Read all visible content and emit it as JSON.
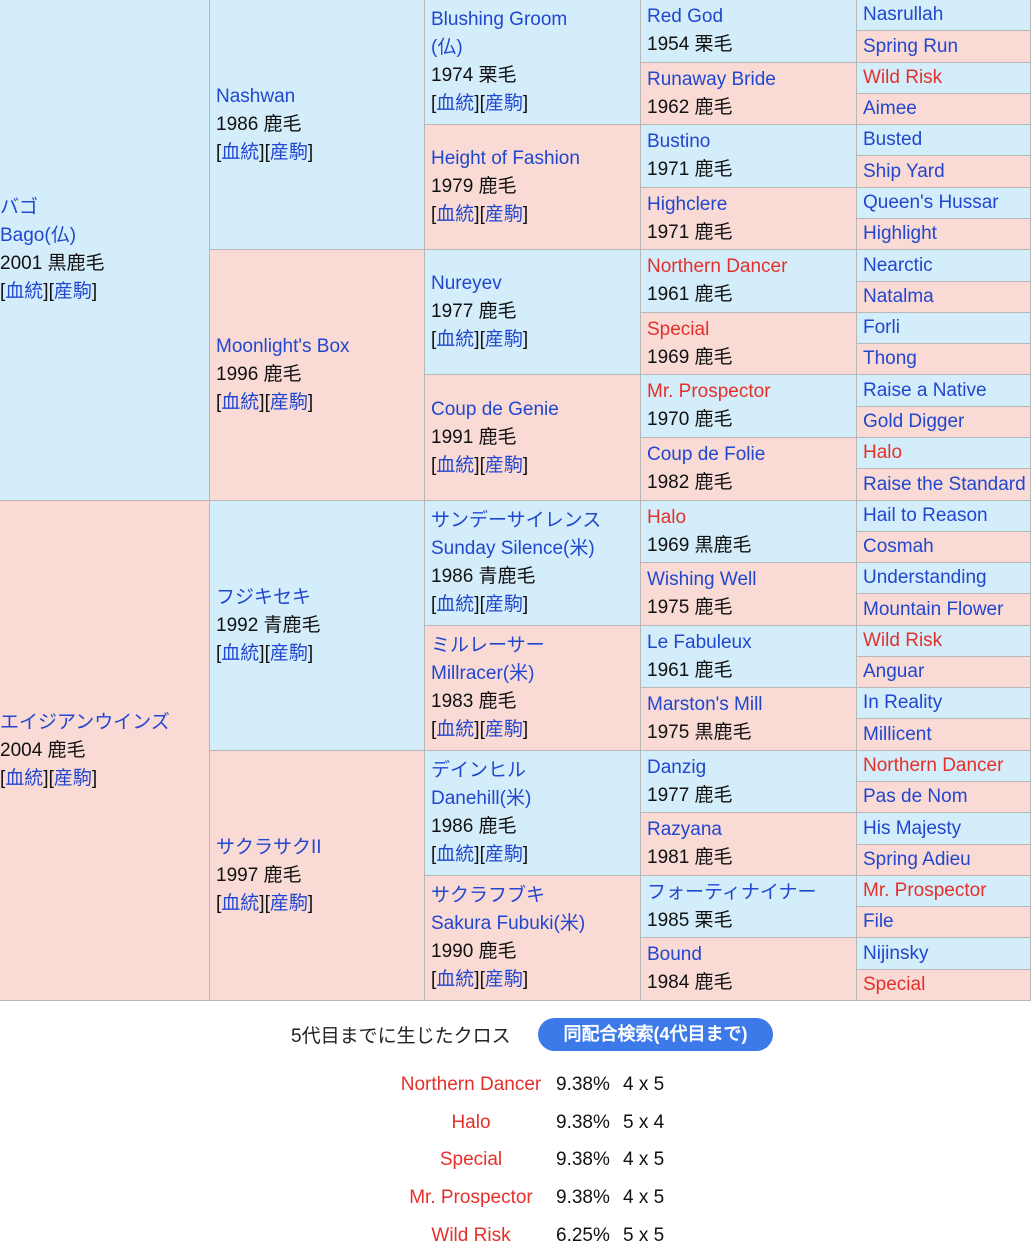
{
  "links": {
    "blood": "血統",
    "foals": "産駒"
  },
  "gen1": [
    {
      "names": [
        "バゴ",
        "Bago(仏)"
      ],
      "info": "2001 黒鹿毛"
    },
    {
      "names": [
        "エイジアンウインズ"
      ],
      "info": "2004 鹿毛"
    }
  ],
  "gen2": [
    {
      "names": [
        "Nashwan"
      ],
      "info": "1986 鹿毛"
    },
    {
      "names": [
        "Moonlight's Box"
      ],
      "info": "1996 鹿毛"
    },
    {
      "names": [
        "フジキセキ"
      ],
      "info": "1992 青鹿毛"
    },
    {
      "names": [
        "サクラサクII"
      ],
      "info": "1997 鹿毛"
    }
  ],
  "gen3": [
    {
      "names": [
        "Blushing Groom",
        "(仏)"
      ],
      "info": "1974 栗毛"
    },
    {
      "names": [
        "Height of Fashion"
      ],
      "info": "1979 鹿毛"
    },
    {
      "names": [
        "Nureyev"
      ],
      "info": "1977 鹿毛"
    },
    {
      "names": [
        "Coup de Genie"
      ],
      "info": "1991 鹿毛"
    },
    {
      "names": [
        "サンデーサイレンス",
        "Sunday Silence(米)"
      ],
      "info": "1986 青鹿毛"
    },
    {
      "names": [
        "ミルレーサー",
        "Millracer(米)"
      ],
      "info": "1983 鹿毛"
    },
    {
      "names": [
        "デインヒル",
        "Danehill(米)"
      ],
      "info": "1986 鹿毛"
    },
    {
      "names": [
        "サクラフブキ",
        "Sakura Fubuki(米)"
      ],
      "info": "1990 鹿毛"
    }
  ],
  "gen4": [
    {
      "name": "Red God",
      "info": "1954 栗毛",
      "cross": false
    },
    {
      "name": "Runaway Bride",
      "info": "1962 鹿毛",
      "cross": false
    },
    {
      "name": "Bustino",
      "info": "1971 鹿毛",
      "cross": false
    },
    {
      "name": "Highclere",
      "info": "1971 鹿毛",
      "cross": false
    },
    {
      "name": "Northern Dancer",
      "info": "1961 鹿毛",
      "cross": true
    },
    {
      "name": "Special",
      "info": "1969 鹿毛",
      "cross": true
    },
    {
      "name": "Mr. Prospector",
      "info": "1970 鹿毛",
      "cross": true
    },
    {
      "name": "Coup de Folie",
      "info": "1982 鹿毛",
      "cross": false
    },
    {
      "name": "Halo",
      "info": "1969 黒鹿毛",
      "cross": true
    },
    {
      "name": "Wishing Well",
      "info": "1975 鹿毛",
      "cross": false
    },
    {
      "name": "Le Fabuleux",
      "info": "1961 鹿毛",
      "cross": false
    },
    {
      "name": "Marston's Mill",
      "info": "1975 黒鹿毛",
      "cross": false
    },
    {
      "name": "Danzig",
      "info": "1977 鹿毛",
      "cross": false
    },
    {
      "name": "Razyana",
      "info": "1981 鹿毛",
      "cross": false
    },
    {
      "name": "フォーティナイナー",
      "info": "1985 栗毛",
      "cross": false
    },
    {
      "name": "Bound",
      "info": "1984 鹿毛",
      "cross": false
    }
  ],
  "gen5": [
    {
      "name": "Nasrullah",
      "cross": false
    },
    {
      "name": "Spring Run",
      "cross": false
    },
    {
      "name": "Wild Risk",
      "cross": true
    },
    {
      "name": "Aimee",
      "cross": false
    },
    {
      "name": "Busted",
      "cross": false
    },
    {
      "name": "Ship Yard",
      "cross": false
    },
    {
      "name": "Queen's Hussar",
      "cross": false
    },
    {
      "name": "Highlight",
      "cross": false
    },
    {
      "name": "Nearctic",
      "cross": false
    },
    {
      "name": "Natalma",
      "cross": false
    },
    {
      "name": "Forli",
      "cross": false
    },
    {
      "name": "Thong",
      "cross": false
    },
    {
      "name": "Raise a Native",
      "cross": false
    },
    {
      "name": "Gold Digger",
      "cross": false
    },
    {
      "name": "Halo",
      "cross": true
    },
    {
      "name": "Raise the Standard",
      "cross": false
    },
    {
      "name": "Hail to Reason",
      "cross": false
    },
    {
      "name": "Cosmah",
      "cross": false
    },
    {
      "name": "Understanding",
      "cross": false
    },
    {
      "name": "Mountain Flower",
      "cross": false
    },
    {
      "name": "Wild Risk",
      "cross": true
    },
    {
      "name": "Anguar",
      "cross": false
    },
    {
      "name": "In Reality",
      "cross": false
    },
    {
      "name": "Millicent",
      "cross": false
    },
    {
      "name": "Northern Dancer",
      "cross": true
    },
    {
      "name": "Pas de Nom",
      "cross": false
    },
    {
      "name": "His Majesty",
      "cross": false
    },
    {
      "name": "Spring Adieu",
      "cross": false
    },
    {
      "name": "Mr. Prospector",
      "cross": true
    },
    {
      "name": "File",
      "cross": false
    },
    {
      "name": "Nijinsky",
      "cross": false
    },
    {
      "name": "Special",
      "cross": true
    }
  ],
  "crosses": {
    "title": "5代目までに生じたクロス",
    "search_button": "同配合検索(4代目まで)",
    "items": [
      {
        "name": "Northern Dancer",
        "percent": "9.38%",
        "gens": "4 x 5"
      },
      {
        "name": "Halo",
        "percent": "9.38%",
        "gens": "5 x 4"
      },
      {
        "name": "Special",
        "percent": "9.38%",
        "gens": "4 x 5"
      },
      {
        "name": "Mr. Prospector",
        "percent": "9.38%",
        "gens": "4 x 5"
      },
      {
        "name": "Wild Risk",
        "percent": "6.25%",
        "gens": "5 x 5"
      }
    ]
  }
}
